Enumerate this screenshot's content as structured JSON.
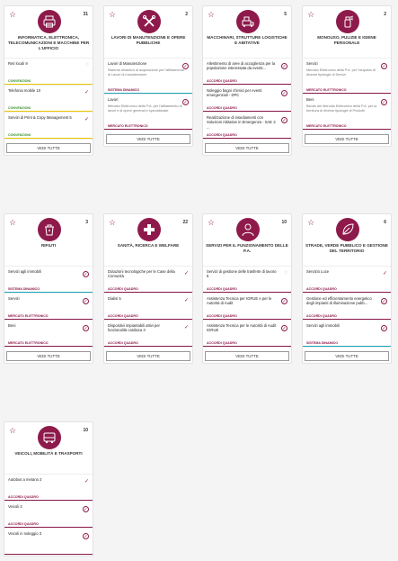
{
  "vedi_label": "VEDI TUTTE",
  "colors": {
    "brand": "#8e1a4b",
    "teal": "#1da3b3",
    "yellow": "#e9c500"
  },
  "categories": [
    {
      "title": "INFORMATICA, ELETTRONICA, TELECOMUNICAZIONI E MACCHINE PER L'UFFICIO",
      "count": "31",
      "icon": "printer-icon",
      "items": [
        {
          "title": "Reti locali 9",
          "desc": "",
          "tag": "CONVENZIONI",
          "mark": "spinner"
        },
        {
          "title": "Telefonia mobile 10",
          "desc": "",
          "tag": "CONVENZIONI",
          "mark": "check"
        },
        {
          "title": "Servizi di Print & Copy Management 5",
          "desc": "",
          "tag": "CONVENZIONI",
          "mark": "check"
        }
      ]
    },
    {
      "title": "LAVORI DI MANUTENZIONE E OPERE PUBBLICHE",
      "count": "2",
      "icon": "tools-icon",
      "items": [
        {
          "title": "Lavori di Manutenzione",
          "desc": "Sistema dinamico di acquisizione per l'affidamento di Lavori di manutenzione",
          "tag": "SISTEMA DINAMICO",
          "mark": "circle"
        },
        {
          "title": "Lavori",
          "desc": "Mercato Elettronico della P.A. per l'affidamento di lavori e di opere generali e specializzate",
          "tag": "MERCATO ELETTRONICO",
          "mark": "circle"
        }
      ]
    },
    {
      "title": "MACCHINARI, STRUTTURE LOGISTICHE E ABITATIVE",
      "count": "5",
      "icon": "machinery-icon",
      "items": [
        {
          "title": "Allestimento di aree di accoglienza per la popolazione interessata da eventi...",
          "desc": "",
          "tag": "ACCORDI QUADRO",
          "mark": "circle"
        },
        {
          "title": "Noleggio bagni chimici per eventi emergenziali - DPC",
          "desc": "",
          "tag": "ACCORDI QUADRO",
          "mark": "circle"
        },
        {
          "title": "Realizzazione di insediamenti con Soluzioni Abitative in Emergenza - SAE 3 ...",
          "desc": "",
          "tag": "ACCORDI QUADRO",
          "mark": "circle"
        }
      ]
    },
    {
      "title": "MONOUSO, PULIZIE E IGIENE PERSONALE",
      "count": "2",
      "icon": "spray-icon",
      "items": [
        {
          "title": "Servizi",
          "desc": "Mercato Elettronico della P.A. per l'acquisto di diverse tipologie di Servizi",
          "tag": "MERCATO ELETTRONICO",
          "mark": "circle"
        },
        {
          "title": "Beni",
          "desc": "Bando del Mercato Elettronico della P.A. per la fornitura di diverse tipologie di Prodotti",
          "tag": "MERCATO ELETTRONICO",
          "mark": "circle"
        }
      ]
    },
    {
      "title": "RIFIUTI",
      "count": "3",
      "icon": "recycle-icon",
      "items": [
        {
          "title": "Servizi agli immobili",
          "desc": "",
          "tag": "SISTEMA DINAMICO",
          "mark": "circle"
        },
        {
          "title": "Servizi",
          "desc": "",
          "tag": "MERCATO ELETTRONICO",
          "mark": "circle"
        },
        {
          "title": "Beni",
          "desc": "",
          "tag": "MERCATO ELETTRONICO",
          "mark": "circle"
        }
      ]
    },
    {
      "title": "SANITÀ, RICERCA E WELFARE",
      "count": "22",
      "icon": "medical-icon",
      "items": [
        {
          "title": "Dotazioni tecnologiche per le Case della Comunità",
          "desc": "",
          "tag": "ACCORDI QUADRO",
          "mark": "check"
        },
        {
          "title": "Dialisi 5",
          "desc": "",
          "tag": "ACCORDI QUADRO",
          "mark": "check"
        },
        {
          "title": "Dispositivi impiantabili attivi per funzionalità cardiaca 3",
          "desc": "",
          "tag": "ACCORDI QUADRO",
          "mark": "check"
        }
      ]
    },
    {
      "title": "SERVIZI PER IL FUNZIONAMENTO DELLE P.A.",
      "count": "10",
      "icon": "person-icon",
      "items": [
        {
          "title": "Servizi di gestione delle trasferte di lavoro 5",
          "desc": "",
          "tag": "ACCORDI QUADRO",
          "mark": "spinner"
        },
        {
          "title": "Assistenza Tecnica per IGRUE e per le Autorità di Audit",
          "desc": "",
          "tag": "ACCORDI QUADRO",
          "mark": "circle"
        },
        {
          "title": "Assistenza Tecnica per le Autorità di Audit IGRUE",
          "desc": "",
          "tag": "ACCORDI QUADRO",
          "mark": "circle"
        }
      ]
    },
    {
      "title": "STRADE, VERDE PUBBLICO E GESTIONE DEL TERRITORIO",
      "count": "6",
      "icon": "leaf-icon",
      "items": [
        {
          "title": "Servizio Luce",
          "desc": "",
          "tag": "ACCORDI QUADRO",
          "mark": "check"
        },
        {
          "title": "Gestione ed efficientamento energetico degli impianti di illuminazione pubb...",
          "desc": "",
          "tag": "ACCORDI QUADRO",
          "mark": "circle"
        },
        {
          "title": "Servizi agli immobili",
          "desc": "",
          "tag": "SISTEMA DINAMICO",
          "mark": "circle"
        }
      ]
    },
    {
      "title": "VEICOLI, MOBILITÀ E TRASPORTI",
      "count": "10",
      "icon": "bus-icon",
      "items": [
        {
          "title": "Autobus a metano 2",
          "desc": "",
          "tag": "ACCORDI QUADRO",
          "mark": "check"
        },
        {
          "title": "Veicoli 3",
          "desc": "",
          "tag": "ACCORDI QUADRO",
          "mark": "circle"
        },
        {
          "title": "Veicoli in noleggio 3",
          "desc": "",
          "tag": "",
          "mark": "circle"
        }
      ]
    }
  ]
}
